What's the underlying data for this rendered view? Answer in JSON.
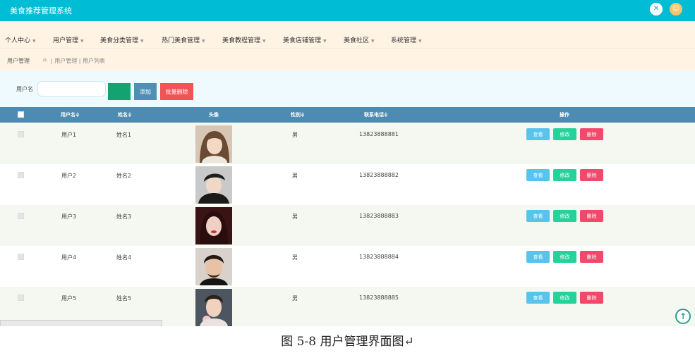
{
  "header": {
    "title": "美食推荐管理系统"
  },
  "nav": {
    "items": [
      {
        "label": "个人中心"
      },
      {
        "label": "用户管理"
      },
      {
        "label": "美食分类管理"
      },
      {
        "label": "热门美食管理"
      },
      {
        "label": "美食教程管理"
      },
      {
        "label": "美食店铺管理"
      },
      {
        "label": "美食社区"
      },
      {
        "label": "系统管理"
      }
    ]
  },
  "breadcrumb": {
    "section": "用户管理",
    "path": "| 用户管理 | 用户列表"
  },
  "search": {
    "label": "用户名",
    "value": "",
    "placeholder": "",
    "search_label": "",
    "add_label": "添加",
    "batch_delete_label": "批量删除"
  },
  "table": {
    "columns": {
      "username": "用户名≑",
      "name": "姓名≑",
      "avatar": "头像",
      "gender": "性别≑",
      "phone": "联系电话≑",
      "actions": "操作"
    },
    "actions": {
      "view": "查看",
      "edit": "修改",
      "delete": "删除"
    },
    "rows": [
      {
        "username": "用户1",
        "name": "姓名1",
        "gender": "男",
        "phone": "13823888881"
      },
      {
        "username": "用户2",
        "name": "姓名2",
        "gender": "男",
        "phone": "13823888882"
      },
      {
        "username": "用户3",
        "name": "姓名3",
        "gender": "男",
        "phone": "13823888883"
      },
      {
        "username": "用户4",
        "name": "姓名4",
        "gender": "男",
        "phone": "13823888884"
      },
      {
        "username": "用户5",
        "name": "姓名5",
        "gender": "男",
        "phone": "13823888885"
      }
    ]
  },
  "status_bar": {
    "url": ""
  },
  "caption": "图 5-8 用户管理界面图↵",
  "colors": {
    "topbar": "#00bcd4",
    "nav_bg": "#fff3e3",
    "table_header": "#4d8bb2",
    "view": "#57c4ee",
    "edit": "#25d39a",
    "delete": "#f1496b"
  }
}
